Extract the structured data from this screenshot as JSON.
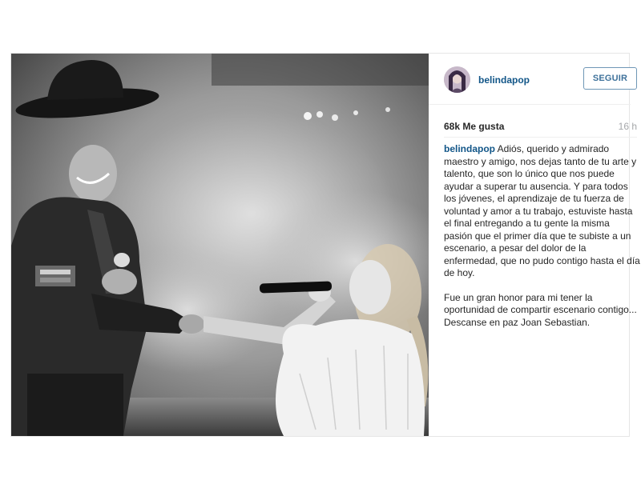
{
  "post": {
    "username": "belindapop",
    "follow_label": "SEGUIR",
    "likes": "68k Me gusta",
    "time_ago": "16 h",
    "caption_author": "belindapop",
    "caption_p1": "Adiós, querido y admirado maestro y amigo, nos dejas tanto de tu arte y talento, que son lo único que nos puede ayudar a superar tu ausencia. Y para todos los jóvenes, el aprendizaje de tu fuerza de voluntad y amor a tu trabajo, estuviste hasta el final entregando a tu gente la misma pasión que el primer día que te subiste a un escenario, a pesar del dolor de la enfermedad, que no pudo contigo hasta el día de hoy.",
    "caption_p2": "Fue un gran honor para mi tener la oportunidad de compartir escenario contigo... Descanse en paz Joan Sebastian."
  },
  "colors": {
    "username": "#125688",
    "follow_border": "#6f97b6",
    "follow_text": "#3f729b",
    "time": "#a5a7aa"
  },
  "icons": {
    "avatar": "profile-photo"
  }
}
